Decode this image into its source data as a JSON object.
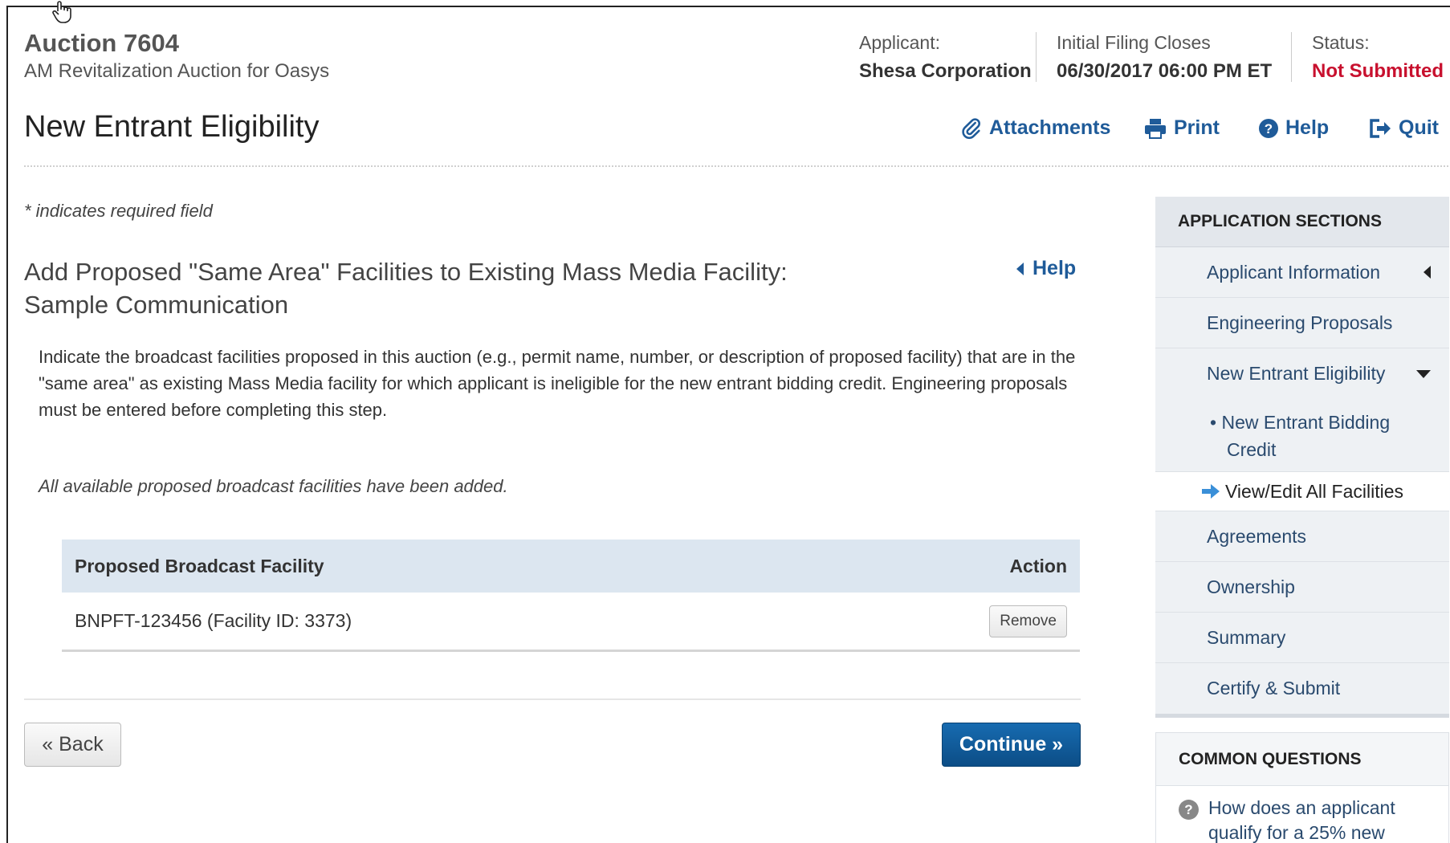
{
  "header": {
    "auction_title": "Auction 7604",
    "auction_subtitle": "AM Revitalization Auction for Oasys",
    "applicant_label": "Applicant:",
    "applicant_value": "Shesa Corporation",
    "filing_label": "Initial Filing Closes",
    "filing_value": "06/30/2017 06:00 PM ET",
    "status_label": "Status:",
    "status_value": "Not Submitted",
    "status_color": "#c8102e"
  },
  "page_title": "New Entrant Eligibility",
  "toolbar": {
    "attachments": "Attachments",
    "print": "Print",
    "help": "Help",
    "quit": "Quit"
  },
  "main": {
    "required_note": "* indicates required field",
    "section_title": "Add Proposed \"Same Area\" Facilities to Existing Mass Media Facility: Sample Communication",
    "help_link": "Help",
    "description": "Indicate the broadcast facilities proposed in this auction (e.g., permit name, number, or description of proposed facility) that are in the \"same area\" as existing Mass Media facility for which applicant is ineligible for the new entrant bidding credit. Engineering proposals must be entered before completing this step.",
    "available_note": "All available proposed broadcast facilities have been added.",
    "table": {
      "columns": [
        "Proposed Broadcast Facility",
        "Action"
      ],
      "rows": [
        {
          "facility": "BNPFT-123456 (Facility ID: 3373)",
          "action": "Remove"
        }
      ]
    },
    "back_button": "« Back",
    "continue_button": "Continue »"
  },
  "sidebar": {
    "heading": "APPLICATION SECTIONS",
    "items": [
      {
        "label": "Applicant Information"
      },
      {
        "label": "Engineering Proposals"
      },
      {
        "label": "New Entrant Eligibility"
      },
      {
        "label": "Agreements"
      },
      {
        "label": "Ownership"
      },
      {
        "label": "Summary"
      },
      {
        "label": "Certify & Submit"
      }
    ],
    "sub_bullet": "•",
    "sub_item_line1": "New Entrant Bidding",
    "sub_item_line2": "Credit",
    "current_item": "View/Edit All Facilities"
  },
  "faq": {
    "heading": "COMMON QUESTIONS",
    "question_line1": "How does an applicant",
    "question_line2": "qualify for a 25% new",
    "icon_glyph": "?"
  },
  "colors": {
    "link": "#1f5b99",
    "accent_button": "#0c4d86",
    "table_header": "#dce6f0"
  }
}
